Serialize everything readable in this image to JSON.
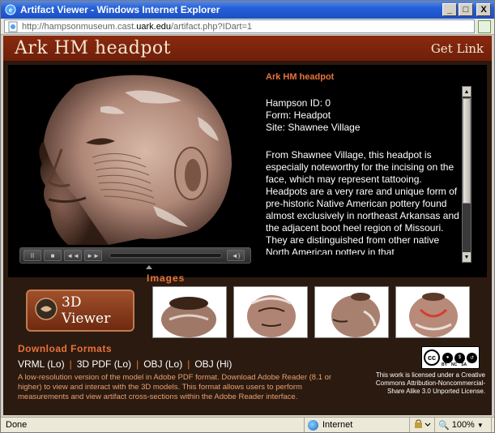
{
  "window": {
    "title": "Artifact Viewer - Windows Internet Explorer",
    "minimize": "_",
    "maximize": "□",
    "close": "X"
  },
  "address": {
    "url_prefix": "http://hampsonmuseum.cast.",
    "url_domain": "uark.edu",
    "url_suffix": "/artifact.php?IDart=1"
  },
  "header": {
    "title": "Ark HM headpot",
    "get_link": "Get Link"
  },
  "info": {
    "title": "Ark HM headpot",
    "hampson_id": "Hampson ID: 0",
    "form": "Form: Headpot",
    "site": "Site: Shawnee Village",
    "description": "From Shawnee Village, this headpot is especially noteworthy for the incising on the face, which may represent tattooing. Headpots are a very rare and unique form of pre-historic Native American pottery found almost exclusively in northeast Arkansas and the adjacent boot heel region of Missouri. They are distinguished from other native North American pottery in that"
  },
  "media": {
    "pause": "II",
    "stop": "■",
    "rewind": "◄◄",
    "forward": "►►",
    "volume": "◄)"
  },
  "images": {
    "label": "Images",
    "viewer_button": "3D Viewer"
  },
  "downloads": {
    "title": "Download Formats",
    "links": [
      "VRML (Lo)",
      "3D PDF (Lo)",
      "OBJ (Lo)",
      "OBJ (Hi)"
    ],
    "separator": "|",
    "description": "A low-resolution version of the model in Adobe PDF format. Download Adobe Reader (8.1 or higher) to view and interact with the 3D models.  This format allows users to perform measurements and view artifact cross-sections within the Adobe Reader interface."
  },
  "license": {
    "badge_cc": "cc",
    "badge_tags": [
      "BY",
      "NC",
      "SA"
    ],
    "text": "This work is licensed under a Creative Commons Attribution-Noncommercial-Share Alike 3.0 Unported License."
  },
  "status": {
    "done": "Done",
    "zone": "Internet",
    "zoom": "100%"
  },
  "colors": {
    "accent": "#e8743a",
    "header_bg": "#7a240c",
    "panel_bg": "#2b1a10"
  }
}
